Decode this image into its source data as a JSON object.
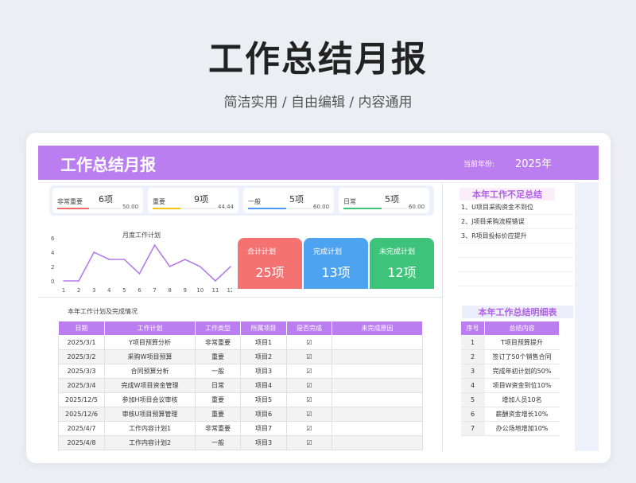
{
  "hero": {
    "title": "工作总结月报",
    "subtitle": "简洁实用 / 自由编辑 / 内容通用"
  },
  "banner": {
    "title": "工作总结月报",
    "year_label": "当前年份:",
    "year": "2025年"
  },
  "stats": [
    {
      "label": "非常重要",
      "count": "6项",
      "value": "50.00",
      "color": "#f06a6a",
      "fraction": 0.5
    },
    {
      "label": "重要",
      "count": "9项",
      "value": "44.44",
      "color": "#f5c518",
      "fraction": 0.44
    },
    {
      "label": "一般",
      "count": "5项",
      "value": "60.00",
      "color": "#4a9af5",
      "fraction": 0.6
    },
    {
      "label": "日常",
      "count": "5项",
      "value": "60.00",
      "color": "#3ec47a",
      "fraction": 0.6
    }
  ],
  "chart_data": {
    "type": "line",
    "title": "月度工作计划",
    "x": [
      1,
      2,
      3,
      4,
      5,
      6,
      7,
      8,
      9,
      10,
      11,
      12
    ],
    "values": [
      0,
      0,
      4,
      3,
      3,
      1,
      5,
      2,
      3,
      2,
      0,
      2
    ],
    "ylim": [
      0,
      6
    ],
    "yticks": [
      "0",
      "2",
      "4",
      "6"
    ],
    "line_color": "#b67be8"
  },
  "plans": [
    {
      "title": "合计计划",
      "value": "25项",
      "color": "#f47272"
    },
    {
      "title": "完成计划",
      "value": "13项",
      "color": "#4da3f0"
    },
    {
      "title": "未完成计划",
      "value": "12项",
      "color": "#3ec47a"
    }
  ],
  "issues": {
    "title": "本年工作不足总结",
    "items": [
      "1、U项目采购资金不到位",
      "2、J项目采购流程错误",
      "3、R项目投标价应提升"
    ]
  },
  "main_table": {
    "title": "本年工作计划及完成情况",
    "headers": [
      "日期",
      "工作计划",
      "工作类型",
      "所属项目",
      "是否完成",
      "未完成原因"
    ],
    "check": "☑",
    "rows": [
      {
        "date": "2025/3/1",
        "plan": "Y项目预算分析",
        "type": "非常重要",
        "project": "项目1"
      },
      {
        "date": "2025/3/2",
        "plan": "采购W项目预算",
        "type": "重要",
        "project": "项目2"
      },
      {
        "date": "2025/3/3",
        "plan": "合同预算分析",
        "type": "一般",
        "project": "项目3"
      },
      {
        "date": "2025/3/4",
        "plan": "完成W项目资金管理",
        "type": "日常",
        "project": "项目4"
      },
      {
        "date": "2025/12/5",
        "plan": "参加H项目会议审核",
        "type": "重要",
        "project": "项目5"
      },
      {
        "date": "2025/12/6",
        "plan": "审核U项目预算管理",
        "type": "重要",
        "project": "项目6"
      },
      {
        "date": "2025/4/7",
        "plan": "工作内容计划1",
        "type": "非常重要",
        "project": "项目7"
      },
      {
        "date": "2025/4/8",
        "plan": "工作内容计划2",
        "type": "一般",
        "project": "项目3"
      }
    ]
  },
  "detail_table": {
    "title": "本年工作总结明细表",
    "headers": [
      "序号",
      "总结内容"
    ],
    "rows": [
      {
        "n": "1",
        "text": "T项目预算提升"
      },
      {
        "n": "2",
        "text": "签订了50个销售合同"
      },
      {
        "n": "3",
        "text": "完成年初计划的50%"
      },
      {
        "n": "4",
        "text": "项目W资金到位10%"
      },
      {
        "n": "5",
        "text": "增加人员10名"
      },
      {
        "n": "6",
        "text": "薪酬资金增长10%"
      },
      {
        "n": "7",
        "text": "办公场地增加10%"
      }
    ]
  }
}
